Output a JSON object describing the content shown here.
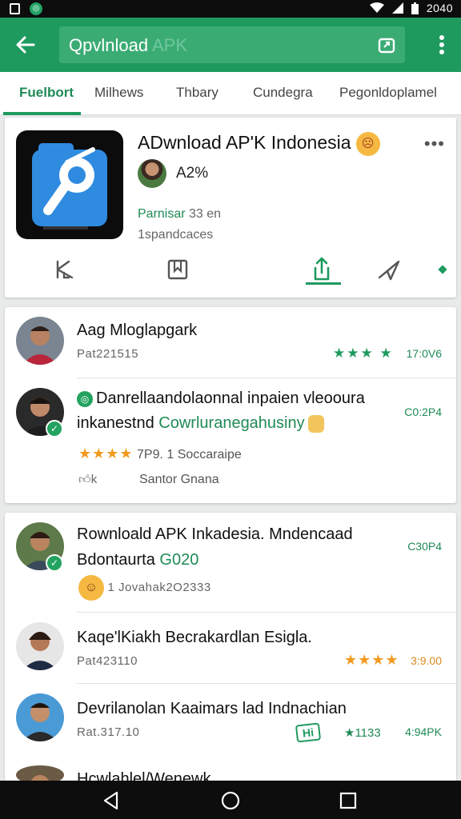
{
  "status_bar": {
    "time": "2040"
  },
  "app_bar": {
    "search_value": "Qpvlnload",
    "search_hint": " APK",
    "icons": [
      "back-arrow-icon",
      "share-box-icon",
      "overflow-menu-icon"
    ]
  },
  "tabs": [
    {
      "label": "Fuelbort",
      "active": true
    },
    {
      "label": "Milhews"
    },
    {
      "label": "Thbary"
    },
    {
      "label": "Cundegra"
    },
    {
      "label": "Pegonldoplamel"
    }
  ],
  "app_card": {
    "title": "ADwnload AP'K Indonesia",
    "developer": "A2%",
    "meta_green": "Parnisar",
    "meta_rest": " 33 en",
    "meta_line2": "1spandcaces",
    "more": "•••",
    "actions": [
      "back-icon",
      "bookmark-icon",
      "share-icon",
      "send-icon"
    ]
  },
  "feed1": [
    {
      "title": "Aag Mloglapgark",
      "sub": "Pat221515",
      "stars": "★★★ ★",
      "time": "17:0V6"
    },
    {
      "title_line1": "Danrellaandolaonnal inpaien vleooura",
      "title_line2_a": "inkanestnd ",
      "title_line2_green": "Cowrluranegahusiny",
      "time": "C0:2P4",
      "stars": "★★★★",
      "rating_text": "7P9.  1 Soccaraipe",
      "like_text": "k",
      "author": "Santor Gnana"
    }
  ],
  "feed2": [
    {
      "title_line1": "Rownloald APK Inkadesia. Mndencaad",
      "title_line2_a": "Bdontaurta ",
      "title_line2_green": "G020",
      "sub": "1 Jovahak2O2333",
      "time": "C30P4"
    },
    {
      "title": "Kaqe'lKiakh Becrakardlan Esigla.",
      "sub": "Pat423110",
      "stars": "★★★★",
      "time": "3:9.00"
    },
    {
      "title": "Devrilanolan Kaaimars lad Indnachian",
      "sub": "Rat.317.10",
      "badge": "Hi",
      "count": "★1133",
      "time": "4:94PK"
    },
    {
      "title": "Hcwlahlel/Wenewk"
    }
  ],
  "colors": {
    "primary": "#1f9a5f",
    "accent_star": "#f29a1f"
  }
}
